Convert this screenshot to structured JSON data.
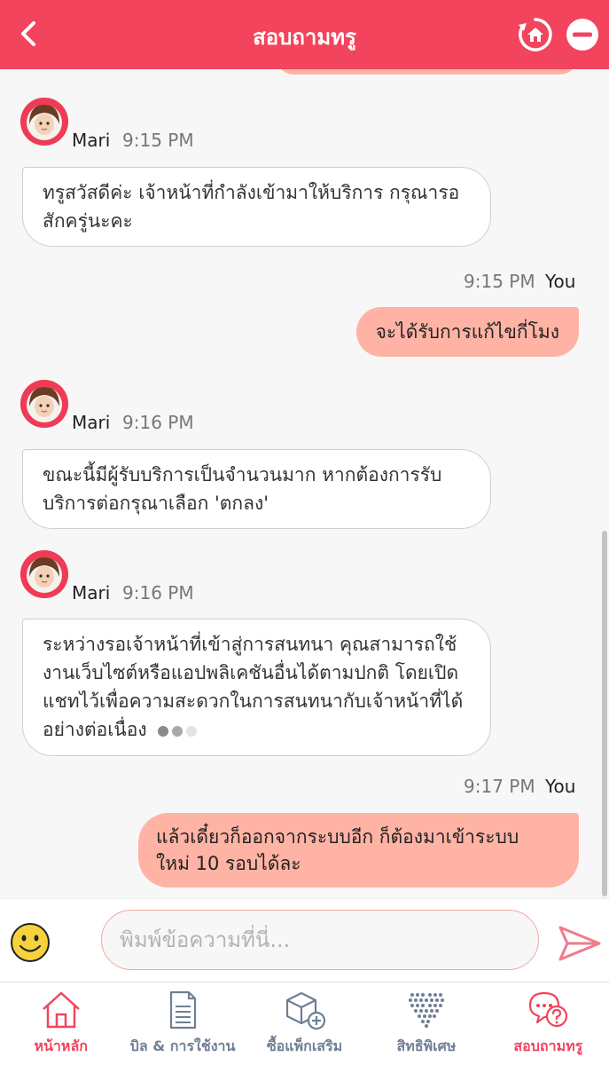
{
  "header": {
    "title": "สอบถามทรู"
  },
  "chat": {
    "messages": [
      {
        "sender": "Mari",
        "time": "9:15 PM",
        "lines": [
          "ทรูสวัสดีค่ะ เจ้าหน้าที่กำลังเข้ามาให้บริการ กรุณารอ",
          "สักครู่นะคะ"
        ]
      },
      {
        "sender": "You",
        "time": "9:15 PM",
        "lines": [
          "จะได้รับการแก้ไขกี่โมง"
        ]
      },
      {
        "sender": "Mari",
        "time": "9:16 PM",
        "lines": [
          "ขณะนี้มีผู้รับบริการเป็นจำนวนมาก หากต้องการรับ",
          "บริการต่อกรุณาเลือก 'ตกลง'"
        ]
      },
      {
        "sender": "Mari",
        "time": "9:16 PM",
        "lines": [
          "ระหว่างรอเจ้าหน้าที่เข้าสู่การสนทนา คุณสามารถใช้",
          "งานเว็บไซต์หรือแอปพลิเคชันอื่นได้ตามปกติ โดยเปิด",
          "แชทไว้เพื่อความสะดวกในการสนทนากับเจ้าหน้าที่ได้",
          "อย่างต่อเนื่อง"
        ]
      },
      {
        "sender": "You",
        "time": "9:17 PM",
        "lines": [
          "แล้วเดี๋ยวก็ออกจากระบบอีก ก็ต้องมาเข้าระบบ",
          "ใหม่ 10 รอบได้ละ"
        ]
      }
    ]
  },
  "input": {
    "placeholder": "พิมพ์ข้อความที่นี่..."
  },
  "nav": {
    "items": [
      {
        "label": "หน้าหลัก",
        "icon": "home-icon",
        "active": true
      },
      {
        "label": "บิล & การใช้งาน",
        "icon": "bill-icon",
        "active": false
      },
      {
        "label": "ซื้อแพ็กเสริม",
        "icon": "package-add-icon",
        "active": false
      },
      {
        "label": "สิทธิพิเศษ",
        "icon": "heart-dots-icon",
        "active": false
      },
      {
        "label": "สอบถามทรู",
        "icon": "chat-question-icon",
        "active": true
      }
    ]
  },
  "colors": {
    "brand": "#f2445c",
    "outgoing_bubble": "#ffb3a5",
    "nav_inactive": "#6f7f95"
  }
}
